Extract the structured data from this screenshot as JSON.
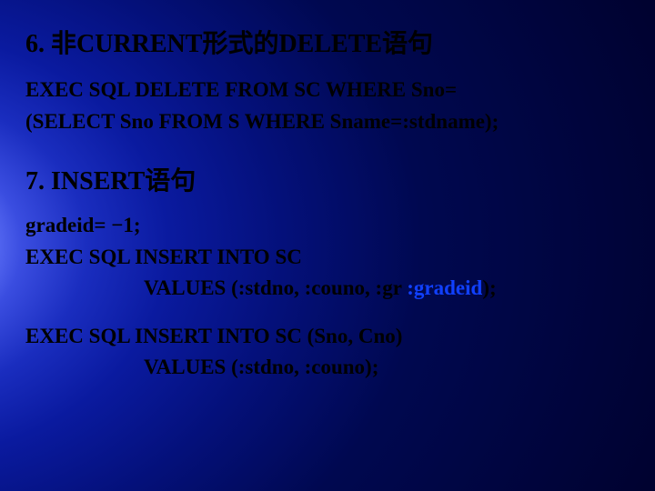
{
  "section1": {
    "heading": "6. 非CURRENT形式的DELETE语句",
    "line1": "EXEC SQL DELETE FROM SC WHERE Sno=",
    "line2": "(SELECT Sno FROM S WHERE  Sname=:stdname);"
  },
  "section2": {
    "heading": "7. INSERT语句",
    "line1": "gradeid= −1;",
    "line2": "EXEC SQL INSERT INTO SC",
    "line3a": "VALUES (:stdno, :couno, :gr ",
    "line3b": ":gradeid",
    "line3c": ");",
    "line4": "EXEC SQL INSERT INTO SC (Sno, Cno)",
    "line5": "VALUES (:stdno, :couno);"
  }
}
